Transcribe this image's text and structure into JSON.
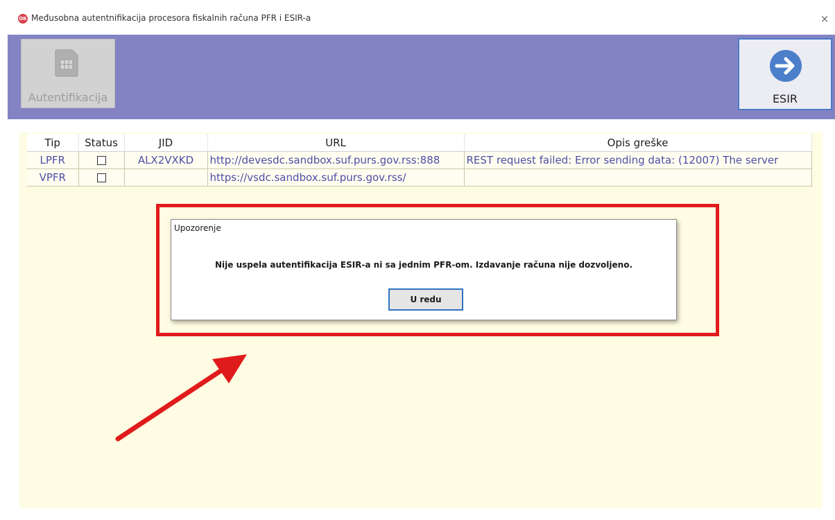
{
  "window": {
    "title": "Međusobna autentnifikacija procesora fiskalnih računa PFR i ESIR-a",
    "close_symbol": "×"
  },
  "toolbar": {
    "auth_button": {
      "label": "Autentifikacija",
      "icon": "sim-card-icon"
    },
    "esir_button": {
      "label": "ESIR",
      "icon": "arrow-right-circle-icon"
    }
  },
  "colors": {
    "toolbar_bg": "#8383c4",
    "content_bg": "#fefde3",
    "link_text": "#4e4ea6",
    "highlight": "#e01b1b",
    "button_border": "#2f73c1"
  },
  "table": {
    "headers": [
      "Tip",
      "Status",
      "JID",
      "URL",
      "Opis greške"
    ],
    "rows": [
      {
        "tip": "LPFR",
        "status_checked": false,
        "jid": "ALX2VXKD",
        "url": "http://devesdc.sandbox.suf.purs.gov.rss:888",
        "opis": "REST request failed: Error sending data: (12007) The server"
      },
      {
        "tip": "VPFR",
        "status_checked": false,
        "jid": "",
        "url": "https://vsdc.sandbox.suf.purs.gov.rss/",
        "opis": ""
      }
    ]
  },
  "dialog": {
    "title": "Upozorenje",
    "message": "Nije uspela autentifikacija ESIR-a ni sa jednim PFR-om. Izdavanje računa nije dozvoljeno.",
    "ok_label": "U redu"
  },
  "annotation": {
    "type": "red-arrow-and-frame",
    "color": "#e01b1b"
  }
}
